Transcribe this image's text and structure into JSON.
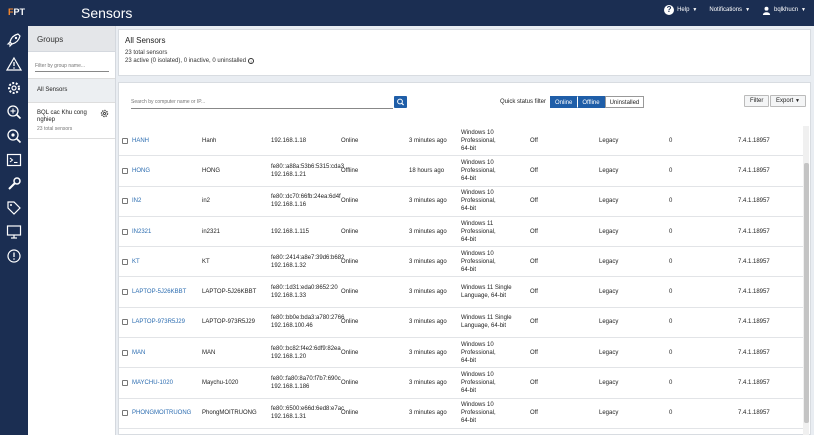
{
  "header": {
    "brand_prefix": "F",
    "brand_rest": "PT",
    "title": "Sensors",
    "help_label": "Help",
    "notifications_label": "Notifications",
    "user_label": "bqlkhucn"
  },
  "groups": {
    "header": "Groups",
    "filter_placeholder": "Filter by group name...",
    "all_label": "All Sensors",
    "items": [
      {
        "name": "BQL cac Khu cong nghiep",
        "count": "23 total sensors"
      }
    ]
  },
  "summary": {
    "title": "All Sensors",
    "total": "23 total sensors",
    "detail": "23 active (0 isolated), 0 inactive, 0 uninstalled"
  },
  "toolbar": {
    "search_placeholder": "Search by computer name or IP...",
    "quick_status_label": "Quick status filter",
    "quick_status": [
      {
        "label": "Online",
        "active": true
      },
      {
        "label": "Offline",
        "active": true
      },
      {
        "label": "Uninstalled",
        "active": false
      }
    ],
    "filter_label": "Filter",
    "export_label": "Export"
  },
  "table": {
    "rows": [
      {
        "host": "HANH",
        "name": "Hanh",
        "ip": [
          "192.168.1.18"
        ],
        "status": "Online",
        "seen": "3 minutes ago",
        "os": [
          "Windows 10 Professional,",
          "64-bit"
        ],
        "rfm": "Off",
        "mode": "Legacy",
        "num": "0",
        "ver": "7.4.1.18957"
      },
      {
        "host": "HONG",
        "name": "HONG",
        "ip": [
          "fe80::a88a:53b6:5315:cda3",
          "192.168.1.21"
        ],
        "status": "Offline",
        "seen": "18 hours ago",
        "os": [
          "Windows 10 Professional,",
          "64-bit"
        ],
        "rfm": "Off",
        "mode": "Legacy",
        "num": "0",
        "ver": "7.4.1.18957"
      },
      {
        "host": "IN2",
        "name": "in2",
        "ip": [
          "fe80::dc70:66fb:24ea:6d4f",
          "192.168.1.16"
        ],
        "status": "Online",
        "seen": "3 minutes ago",
        "os": [
          "Windows 10 Professional,",
          "64-bit"
        ],
        "rfm": "Off",
        "mode": "Legacy",
        "num": "0",
        "ver": "7.4.1.18957"
      },
      {
        "host": "IN2321",
        "name": "in2321",
        "ip": [
          "192.168.1.115"
        ],
        "status": "Online",
        "seen": "3 minutes ago",
        "os": [
          "Windows 11 Professional,",
          "64-bit"
        ],
        "rfm": "Off",
        "mode": "Legacy",
        "num": "0",
        "ver": "7.4.1.18957"
      },
      {
        "host": "KT",
        "name": "KT",
        "ip": [
          "fe80::2414:a8e7:39d6:b682",
          "192.168.1.32"
        ],
        "status": "Online",
        "seen": "3 minutes ago",
        "os": [
          "Windows 10 Professional,",
          "64-bit"
        ],
        "rfm": "Off",
        "mode": "Legacy",
        "num": "0",
        "ver": "7.4.1.18957"
      },
      {
        "host": "LAPTOP-5J26KBBT",
        "name": "LAPTOP-5J26KBBT",
        "ip": [
          "fe80::1d31:eda0:8652:20",
          "192.168.1.33"
        ],
        "status": "Online",
        "seen": "3 minutes ago",
        "os": [
          "Windows 11 Single",
          "Language, 64-bit"
        ],
        "rfm": "Off",
        "mode": "Legacy",
        "num": "0",
        "ver": "7.4.1.18957"
      },
      {
        "host": "LAPTOP-973R5J29",
        "name": "LAPTOP-973R5J29",
        "ip": [
          "fe80::bb0e:bda3:a780:2766",
          "192.168.100.46"
        ],
        "status": "Online",
        "seen": "3 minutes ago",
        "os": [
          "Windows 11 Single",
          "Language, 64-bit"
        ],
        "rfm": "Off",
        "mode": "Legacy",
        "num": "0",
        "ver": "7.4.1.18957"
      },
      {
        "host": "MAN",
        "name": "MAN",
        "ip": [
          "fe80::bc82:f4e2:6df9:82ea",
          "192.168.1.20"
        ],
        "status": "Online",
        "seen": "3 minutes ago",
        "os": [
          "Windows 10 Professional,",
          "64-bit"
        ],
        "rfm": "Off",
        "mode": "Legacy",
        "num": "0",
        "ver": "7.4.1.18957"
      },
      {
        "host": "MAYCHU-1020",
        "name": "Maychu-1020",
        "ip": [
          "fe80::fa80:8a70:f7b7:690c",
          "192.168.1.186"
        ],
        "status": "Online",
        "seen": "3 minutes ago",
        "os": [
          "Windows 10 Professional,",
          "64-bit"
        ],
        "rfm": "Off",
        "mode": "Legacy",
        "num": "0",
        "ver": "7.4.1.18957"
      },
      {
        "host": "PHONGMOITRUONG",
        "name": "PhongMOITRUONG",
        "ip": [
          "fe80::6500:e66d:6ed8:e7ac",
          "192.168.1.31"
        ],
        "status": "Online",
        "seen": "3 minutes ago",
        "os": [
          "Windows 10 Professional,",
          "64-bit"
        ],
        "rfm": "Off",
        "mode": "Legacy",
        "num": "0",
        "ver": "7.4.1.18957"
      }
    ]
  },
  "colors": {
    "nav_bg": "#1b2e52",
    "accent": "#1f5ea8",
    "link": "#2b6cb0",
    "brand_orange": "#ff8b2a"
  },
  "icons": [
    "rocket-icon",
    "alert-icon",
    "gear-icon",
    "search-plus-icon",
    "search-check-icon",
    "terminal-icon",
    "wrench-icon",
    "tag-icon",
    "monitor-icon",
    "info-icon"
  ]
}
